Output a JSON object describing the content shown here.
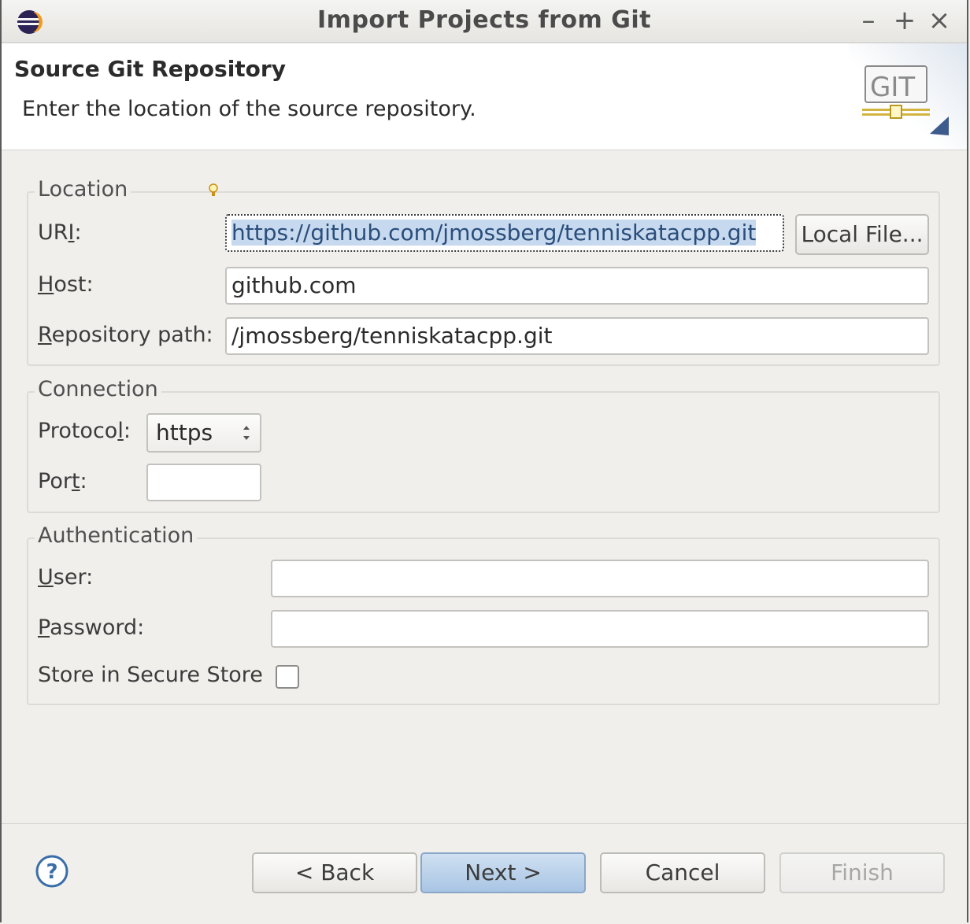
{
  "window": {
    "title": "Import Projects from Git",
    "controls": {
      "minimize": "–",
      "maximize": "+",
      "close": "×"
    }
  },
  "banner": {
    "title": "Source Git Repository",
    "description": "Enter the location of the source repository.",
    "logo_text": "GIT"
  },
  "location": {
    "legend": "Location",
    "uri_label_pre": "UR",
    "uri_label_ul": "I",
    "uri_label_post": ":",
    "uri_value": "https://github.com/jmossberg/tenniskatacpp.git",
    "local_file_button": "Local File...",
    "host_label_ul": "H",
    "host_label_post": "ost:",
    "host_value": "github.com",
    "path_label_ul": "R",
    "path_label_post": "epository path:",
    "path_value": "/jmossberg/tenniskatacpp.git"
  },
  "connection": {
    "legend": "Connection",
    "protocol_label_pre": "Protoco",
    "protocol_label_ul": "l",
    "protocol_label_post": ":",
    "protocol_value": "https",
    "port_label_pre": "Por",
    "port_label_ul": "t",
    "port_label_post": ":",
    "port_value": ""
  },
  "authentication": {
    "legend": "Authentication",
    "user_label_ul": "U",
    "user_label_post": "ser:",
    "user_value": "",
    "password_label_ul": "P",
    "password_label_post": "assword:",
    "password_value": "",
    "store_label": "Store in Secure Store",
    "store_checked": false
  },
  "footer": {
    "help_icon": "help-icon",
    "back": "< Back",
    "next": "Next >",
    "cancel": "Cancel",
    "finish": "Finish"
  },
  "colors": {
    "background": "#f0efec",
    "primary_button": "#a9c5e4",
    "selection": "#c6d9ee"
  }
}
